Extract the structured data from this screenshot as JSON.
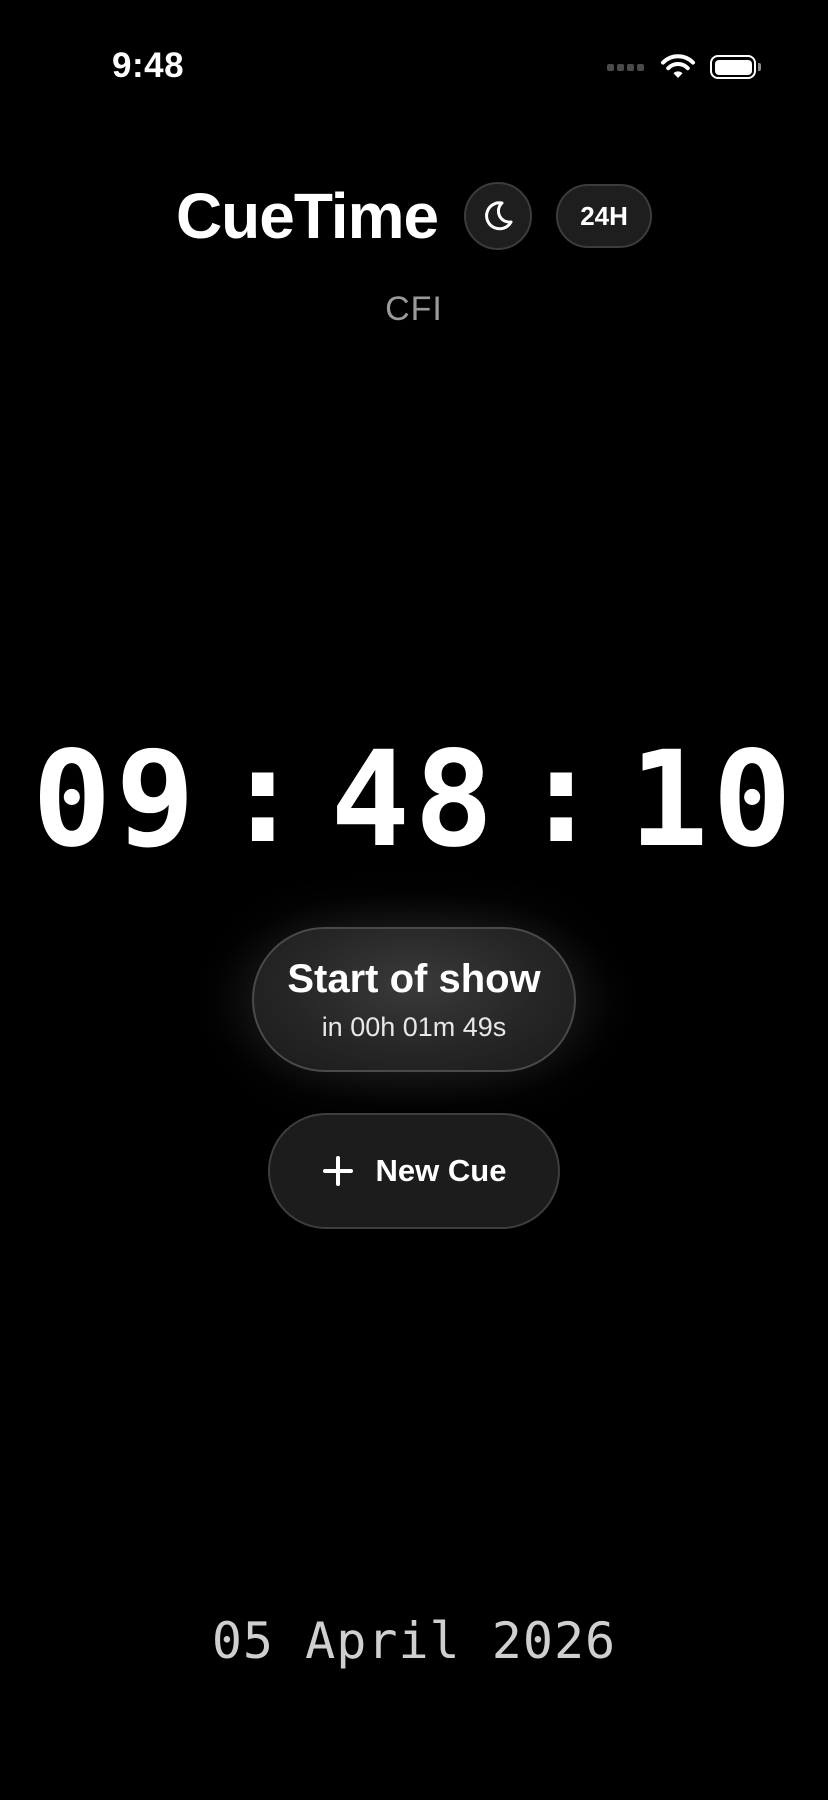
{
  "status_bar": {
    "time": "9:48",
    "icons": [
      "cellular-signal-icon",
      "wifi-icon",
      "battery-icon"
    ]
  },
  "header": {
    "app_title": "CueTime",
    "theme_toggle_icon": "moon-icon",
    "time_format_label": "24H"
  },
  "subtitle": "CFI",
  "clock": {
    "hours": "09",
    "minutes": "48",
    "seconds": "10",
    "separator": ":"
  },
  "next_cue": {
    "name": "Start of show",
    "countdown": "in 00h 01m 49s"
  },
  "new_cue_button": {
    "icon": "plus-icon",
    "label": "New Cue"
  },
  "date": "05 April 2026",
  "colors": {
    "background": "#000000",
    "text": "#ffffff",
    "muted_text": "#9a9a9a",
    "control_fill": "#1e1e1e",
    "control_border": "#3c3c3c"
  }
}
